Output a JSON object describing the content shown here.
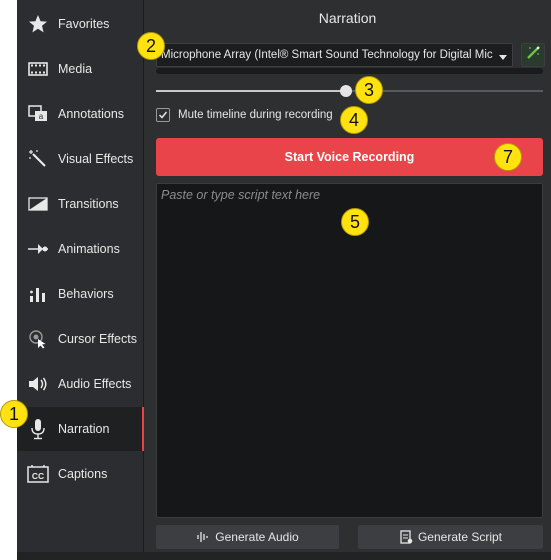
{
  "sidebar": {
    "items": [
      {
        "label": "Favorites",
        "icon": "star-icon"
      },
      {
        "label": "Media",
        "icon": "film-icon"
      },
      {
        "label": "Annotations",
        "icon": "annotation-icon"
      },
      {
        "label": "Visual Effects",
        "icon": "magic-wand-icon"
      },
      {
        "label": "Transitions",
        "icon": "transition-icon"
      },
      {
        "label": "Animations",
        "icon": "animation-icon"
      },
      {
        "label": "Behaviors",
        "icon": "behaviors-icon"
      },
      {
        "label": "Cursor Effects",
        "icon": "cursor-icon"
      },
      {
        "label": "Audio Effects",
        "icon": "speaker-icon"
      },
      {
        "label": "Narration",
        "icon": "microphone-icon",
        "active": true
      },
      {
        "label": "Captions",
        "icon": "captions-icon"
      }
    ]
  },
  "panel": {
    "title": "Narration",
    "mic_device": "Microphone Array (Intel® Smart Sound Technology for Digital Mic",
    "input_level_fraction": 0.49,
    "mute_label": "Mute timeline during recording",
    "mute_checked": true,
    "record_label": "Start Voice Recording",
    "script_placeholder": "Paste or type script text here",
    "generate_audio_label": "Generate Audio",
    "generate_script_label": "Generate Script"
  },
  "callouts": [
    "1",
    "2",
    "3",
    "4",
    "5",
    "7"
  ],
  "colors": {
    "accent": "#e8444a",
    "callout": "#ffe20f",
    "background": "#2d2f31"
  }
}
